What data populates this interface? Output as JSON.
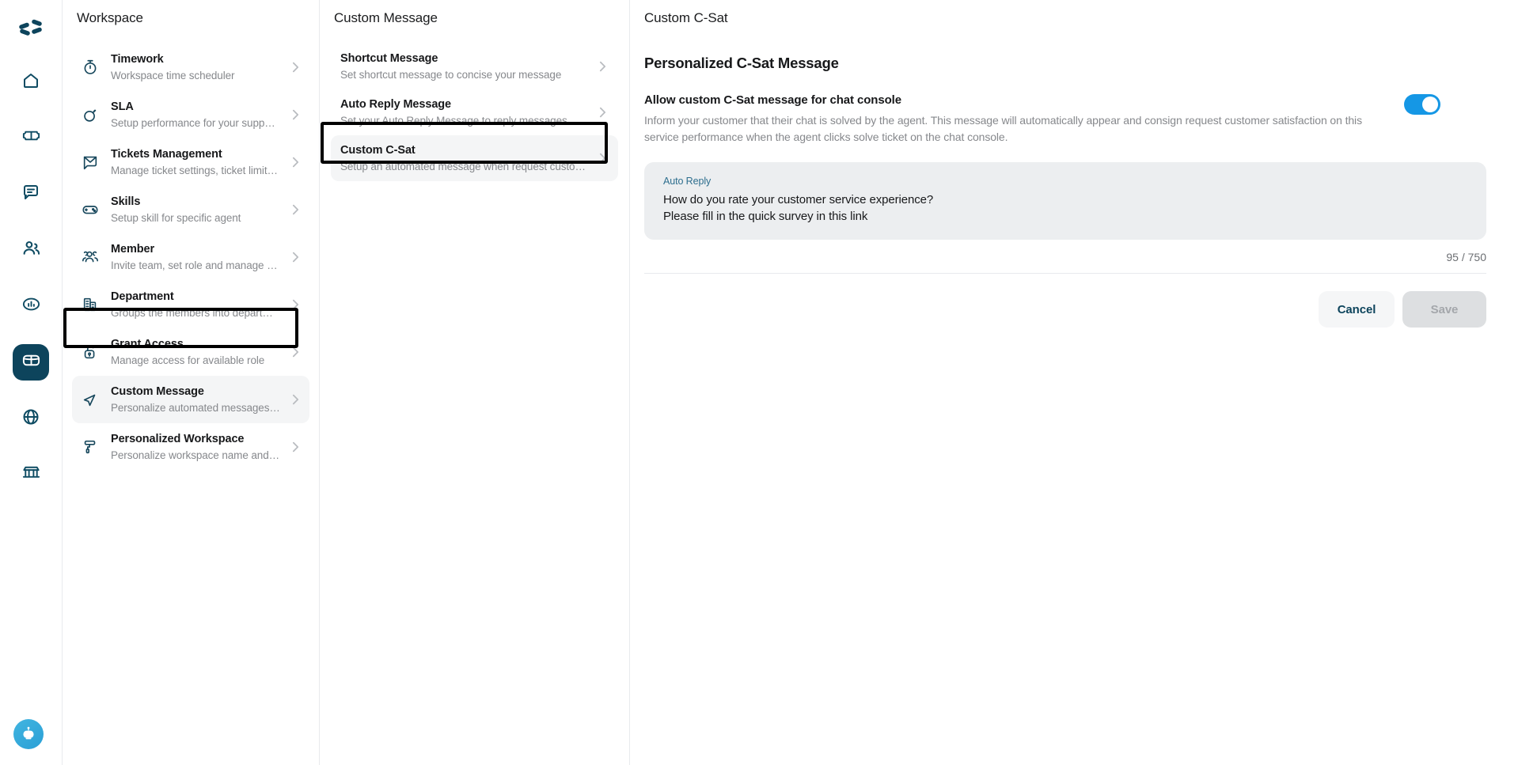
{
  "rail": {
    "logo": "brand-logo-icon",
    "items": [
      {
        "icon": "home-icon",
        "name": "home",
        "active": false
      },
      {
        "icon": "ticket-icon",
        "name": "tickets",
        "active": false
      },
      {
        "icon": "chat-bubble-icon",
        "name": "chat",
        "active": false
      },
      {
        "icon": "contacts-icon",
        "name": "contacts",
        "active": false
      },
      {
        "icon": "analytics-icon",
        "name": "analytics",
        "active": false
      },
      {
        "icon": "workspace-icon",
        "name": "workspace",
        "active": true
      },
      {
        "icon": "globe-icon",
        "name": "channels",
        "active": false
      },
      {
        "icon": "marketplace-icon",
        "name": "marketplace",
        "active": false
      }
    ],
    "bot_avatar": "chatbot-avatar-icon"
  },
  "workspace": {
    "title": "Workspace",
    "items": [
      {
        "icon": "stopwatch-icon",
        "name": "Timework",
        "desc": "Workspace time scheduler",
        "selected": false
      },
      {
        "icon": "sla-target-icon",
        "name": "SLA",
        "desc": "Setup performance for your support t…",
        "selected": false
      },
      {
        "icon": "ticket-envelope-icon",
        "name": "Tickets Management",
        "desc": "Manage ticket settings, ticket limitati…",
        "selected": false
      },
      {
        "icon": "gamepad-icon",
        "name": "Skills",
        "desc": "Setup skill for specific agent",
        "selected": false
      },
      {
        "icon": "people-group-icon",
        "name": "Member",
        "desc": "Invite team, set role and manage you…",
        "selected": false
      },
      {
        "icon": "building-icon",
        "name": "Department",
        "desc": "Groups the members into department",
        "selected": false
      },
      {
        "icon": "unlock-icon",
        "name": "Grant Access",
        "desc": "Manage access for available role",
        "selected": false
      },
      {
        "icon": "send-cursor-icon",
        "name": "Custom Message",
        "desc": "Personalize automated messages ins…",
        "selected": true
      },
      {
        "icon": "paint-roller-icon",
        "name": "Personalized Workspace",
        "desc": "Personalize workspace name and de…",
        "selected": false
      }
    ]
  },
  "custom_message": {
    "title": "Custom Message",
    "items": [
      {
        "name": "Shortcut Message",
        "desc": "Set shortcut message to concise your message",
        "selected": false
      },
      {
        "name": "Auto Reply Message",
        "desc": "Set your Auto Reply Message to reply messages appr…",
        "selected": false
      },
      {
        "name": "Custom C-Sat",
        "desc": "Setup an automated message when request custome…",
        "selected": true
      }
    ]
  },
  "detail": {
    "title": "Custom C-Sat",
    "heading": "Personalized C-Sat Message",
    "allow_label": "Allow custom C-Sat message for chat console",
    "allow_desc": "Inform your customer that their chat is solved by the agent. This message will automatically appear and consign request customer satisfaction on this service performance when the agent clicks solve ticket on the chat console.",
    "toggle_state": "on",
    "bubble": {
      "tag": "Auto Reply",
      "line1": "How do you rate your customer service experience?",
      "line2": "Please fill in the quick survey in this link"
    },
    "counter": "95 / 750",
    "cancel_label": "Cancel",
    "save_label": "Save"
  },
  "colors": {
    "brand_dark": "#0d445c",
    "toggle_on": "#1597e5",
    "selected_bg": "#f4f5f6",
    "bubble_bg": "#eceef0",
    "muted_text": "#86888c"
  }
}
